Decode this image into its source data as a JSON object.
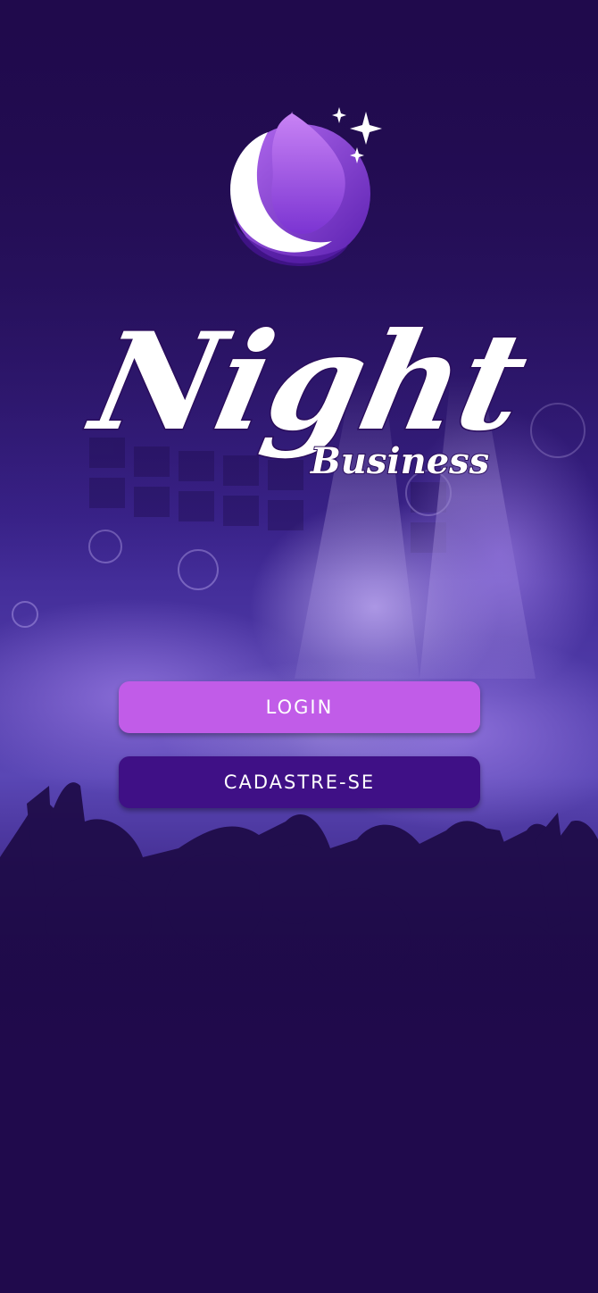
{
  "app": {
    "logo_word_main": "Night",
    "logo_word_sub": "Business"
  },
  "buttons": {
    "login_label": "LOGIN",
    "signup_label": "CADASTRE-SE"
  },
  "colors": {
    "background": "#200a4c",
    "login_button": "#c15ce8",
    "signup_button": "#3f1086",
    "accent_purple": "#8a3fd8",
    "haze": "#7a5ad0"
  },
  "icons": {
    "logo": "moon-flame-icon",
    "stars": "sparkle-stars-icon"
  }
}
